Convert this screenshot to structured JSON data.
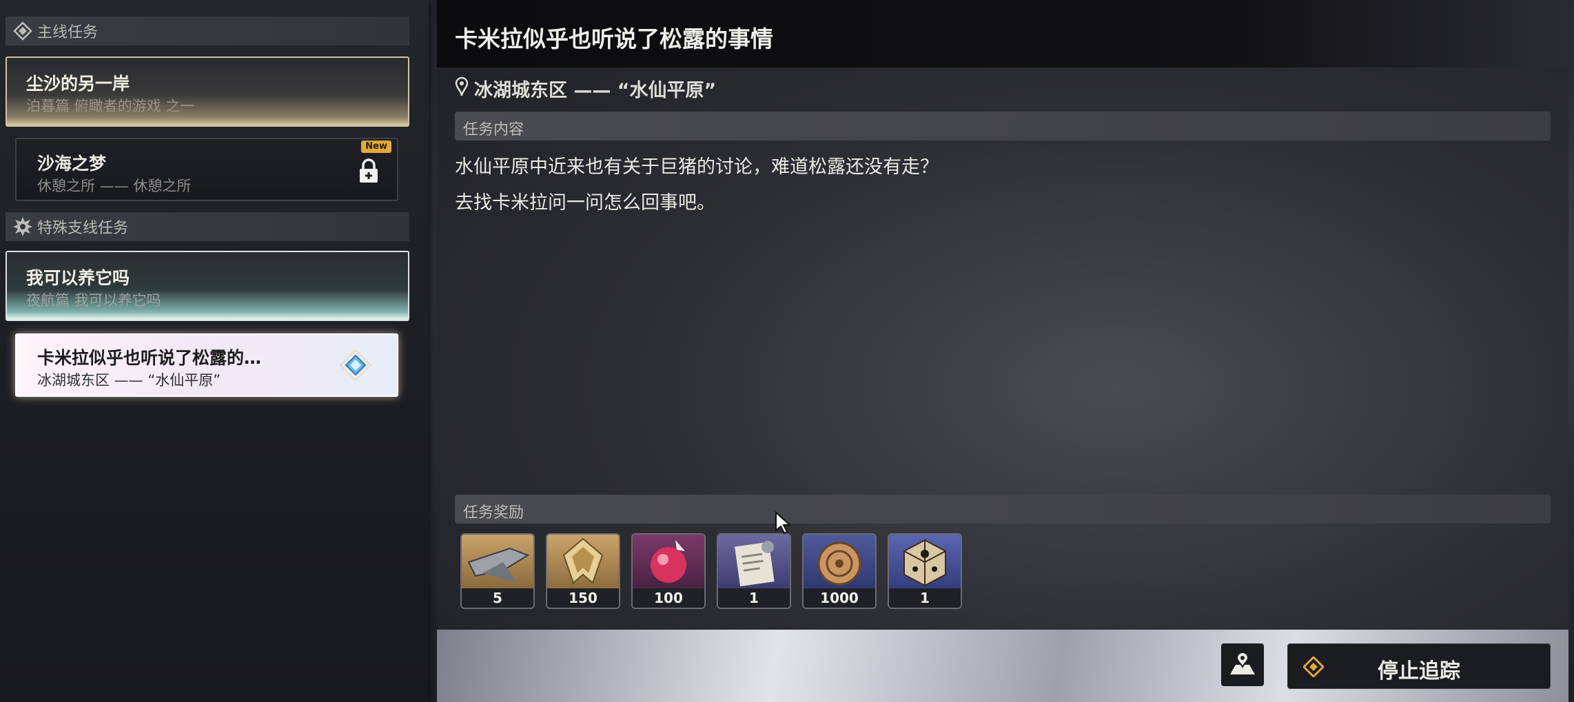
{
  "sidebar": {
    "categories": [
      {
        "label": "主线任务",
        "icon": "main-quest-icon"
      },
      {
        "label": "特殊支线任务",
        "icon": "special-side-quest-icon"
      }
    ],
    "quests": [
      {
        "title": "尘沙的另一岸",
        "subtitle": "泊暮篇 俯瞰者的游戏 之一"
      },
      {
        "title": "沙海之梦",
        "subtitle": "休憩之所 —— 休憩之所",
        "badge": "New",
        "locked": true
      },
      {
        "title": "我可以养它吗",
        "subtitle": "夜航篇 我可以养它吗"
      },
      {
        "title": "卡米拉似乎也听说了松露的…",
        "subtitle": "冰湖城东区 —— “水仙平原”",
        "selected": true
      }
    ]
  },
  "detail": {
    "title": "卡米拉似乎也听说了松露的事情",
    "location": "冰湖城东区 —— “水仙平原”",
    "content_header": "任务内容",
    "description": [
      "水仙平原中近来也有关于巨猪的讨论，难道松露还没有走？",
      "去找卡米拉问一问怎么回事吧。"
    ],
    "rewards_header": "任务奖励",
    "rewards": [
      {
        "icon": "blade-material-icon",
        "count": "5"
      },
      {
        "icon": "gold-crest-icon",
        "count": "150"
      },
      {
        "icon": "crimson-orb-icon",
        "count": "100"
      },
      {
        "icon": "document-scroll-icon",
        "count": "1"
      },
      {
        "icon": "bronze-coin-icon",
        "count": "1000"
      },
      {
        "icon": "dice-cube-icon",
        "count": "1"
      }
    ]
  },
  "footer": {
    "map_button": "map-icon",
    "stop_tracking_label": "停止追踪"
  },
  "colors": {
    "accent_gold": "#e2a83a",
    "selected_quest_bg": "#f3e9f6"
  }
}
